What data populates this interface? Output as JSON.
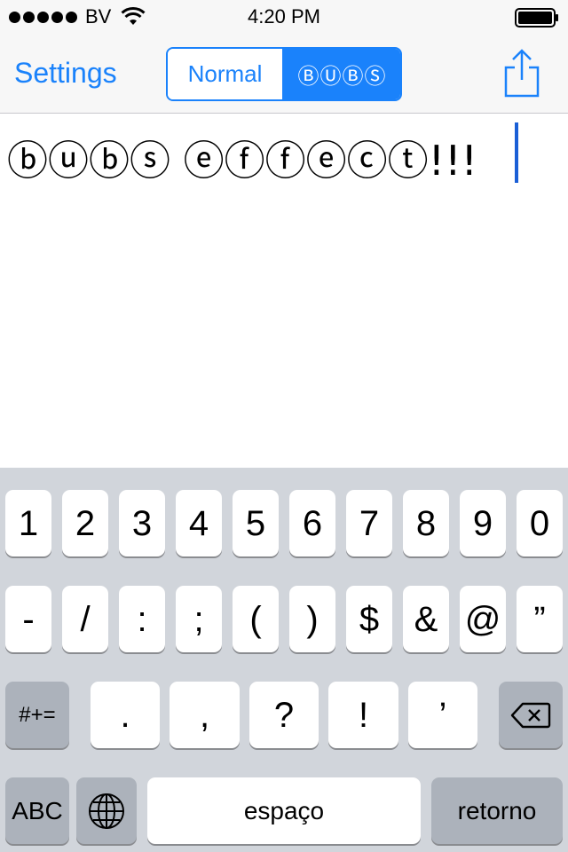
{
  "status_bar": {
    "carrier": "BV",
    "time": "4:20 PM",
    "signal_bars": 5
  },
  "nav": {
    "back_label": "Settings",
    "segments": [
      "Normal",
      "ⒷⓊⒷⓈ"
    ],
    "selected_segment": 1,
    "share_icon": "share-icon",
    "accent_color": "#1a82fb"
  },
  "editor": {
    "text": "ⓑⓤⓑⓢ ⓔⓕⓕⓔⓒⓣ!!!",
    "caret_color": "#1a5fd6"
  },
  "keyboard": {
    "row1": [
      "1",
      "2",
      "3",
      "4",
      "5",
      "6",
      "7",
      "8",
      "9",
      "0"
    ],
    "row2": [
      "-",
      "/",
      ":",
      ";",
      "(",
      ")",
      "$",
      "&",
      "@",
      "”"
    ],
    "row3": {
      "symbols_key": "#+=",
      "keys": [
        ".",
        ",",
        "?",
        "!",
        "’"
      ],
      "delete_icon": "backspace-icon"
    },
    "row4": {
      "abc_key": "ABC",
      "globe_icon": "globe-icon",
      "space_key": "espaço",
      "return_key": "retorno"
    }
  }
}
